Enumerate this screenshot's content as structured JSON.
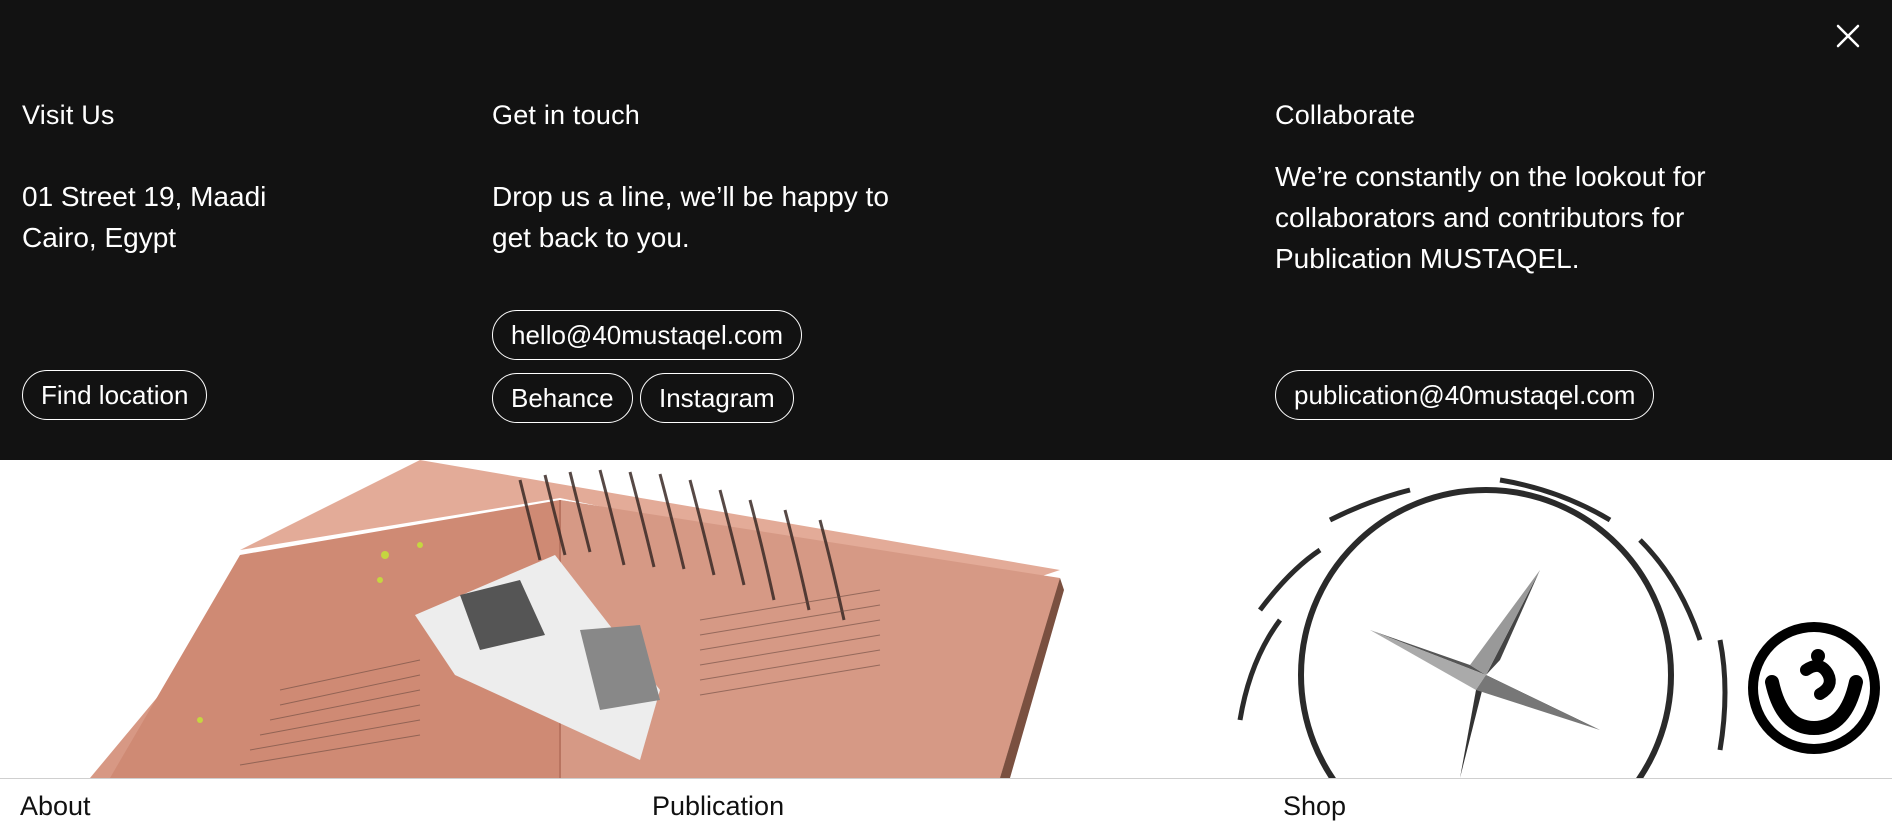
{
  "contact": {
    "visit": {
      "heading": "Visit Us",
      "address": "01 Street 19, Maadi\nCairo, Egypt",
      "button_label": "Find location"
    },
    "touch": {
      "heading": "Get in touch",
      "text": "Drop us a line, we’ll be happy to\nget back to you.",
      "email_label": "hello@40mustaqel.com",
      "behance_label": "Behance",
      "instagram_label": "Instagram"
    },
    "collab": {
      "heading": "Collaborate",
      "text": "We’re constantly on the lookout for\ncollaborators and contributors for\nPublication MUSTAQEL.",
      "email_label": "publication@40mustaqel.com"
    }
  },
  "icons": {
    "close": "close-icon",
    "logo": "mustaqel-logo-icon"
  },
  "nav": {
    "about_label": "About",
    "publication_label": "Publication",
    "shop_label": "Shop"
  },
  "colors": {
    "overlay_bg": "#121212",
    "text_light": "#ffffff",
    "magazine_pink": "#d89a86",
    "nav_text": "#111111"
  }
}
